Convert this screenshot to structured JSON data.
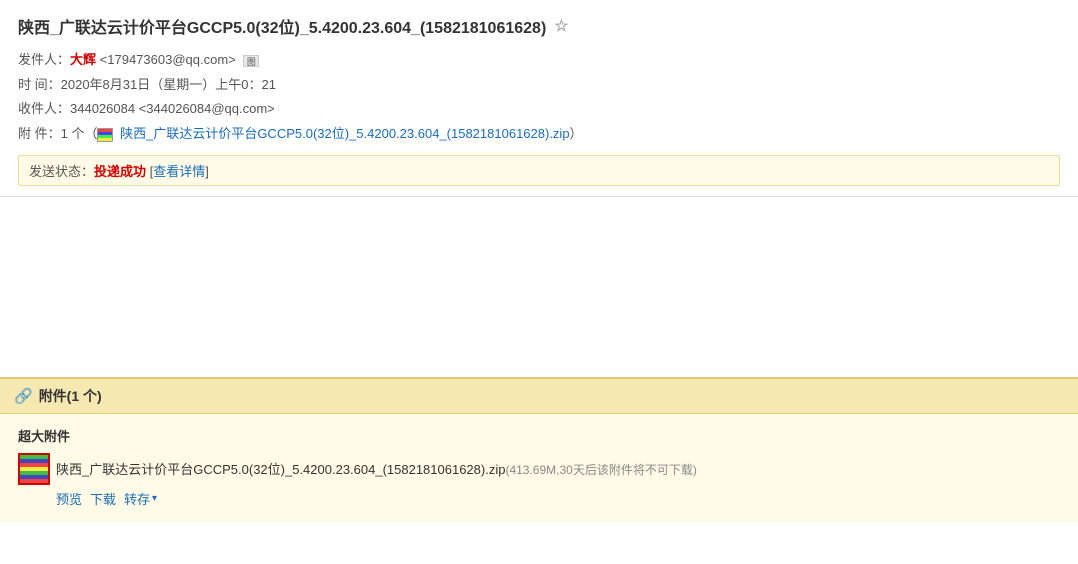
{
  "email": {
    "subject": "陕西_广联达云计价平台GCCP5.0(32位)_5.4200.23.604_(1582181061628)",
    "star_label": "☆",
    "from_label": "发件人：",
    "sender_name": "大辉",
    "sender_email": "<179473603@qq.com>",
    "addr_icon_text": "图",
    "time_label": "时  间：",
    "time_value": "2020年8月31日（星期一）上午0：21",
    "to_label": "收件人：",
    "recipient": "344026084 <344026084@qq.com>",
    "attachment_label": "附  件：",
    "attachment_count": "1 个（",
    "attachment_inline_name": "陕西_广联达云计价平台GCCP5.0(32位)_5.4200.23.604_(1582181061628).zip",
    "attachment_inline_suffix": "）",
    "send_status_label": "发送状态：",
    "send_status_value": "投递成功",
    "send_status_detail": "查看详情",
    "attachment_section_title": "附件(1 个)",
    "super_attachment_label": "超大附件",
    "attachment_filename": "陕西_广联达云计价平台GCCP5.0(32位)_5.4200.23.604_(1582181061628).zip",
    "attachment_fileinfo": "(413.69M,30天后该附件将不可下载)",
    "action_preview": "预览",
    "action_download": "下载",
    "action_save": "转存",
    "action_save_arrow": "▾"
  }
}
